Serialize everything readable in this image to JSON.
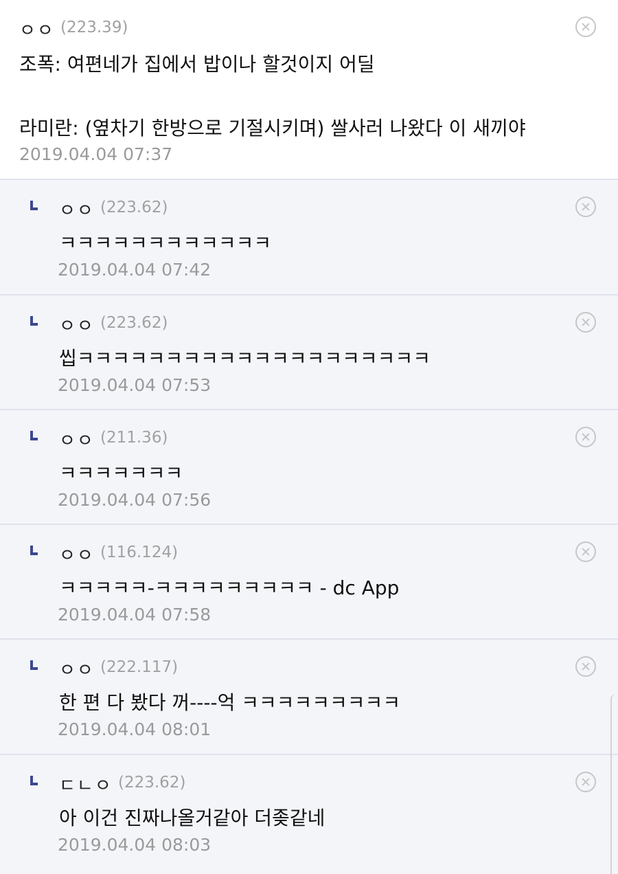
{
  "main_comment": {
    "nickname": "ㅇㅇ",
    "ip": "(223.39)",
    "line1": "조폭: 여편네가 집에서 밥이나 할것이지 어딜",
    "line2": "라미란: (옆차기 한방으로 기절시키며) 쌀사러 나왔다 이 새끼야",
    "date": "2019.04.04 07:37"
  },
  "replies": [
    {
      "nickname": "ㅇㅇ",
      "ip": "(223.62)",
      "text": "ㅋㅋㅋㅋㅋㅋㅋㅋㅋㅋㅋㅋ",
      "date": "2019.04.04 07:42"
    },
    {
      "nickname": "ㅇㅇ",
      "ip": "(223.62)",
      "text": "씹ㅋㅋㅋㅋㅋㅋㅋㅋㅋㅋㅋㅋㅋㅋㅋㅋㅋㅋㅋㅋ",
      "date": "2019.04.04 07:53"
    },
    {
      "nickname": "ㅇㅇ",
      "ip": "(211.36)",
      "text": "ㅋㅋㅋㅋㅋㅋㅋ",
      "date": "2019.04.04 07:56"
    },
    {
      "nickname": "ㅇㅇ",
      "ip": "(116.124)",
      "text": "ㅋㅋㅋㅋㅋ-ㅋㅋㅋㅋㅋㅋㅋㅋㅋ - dc App",
      "date": "2019.04.04 07:58"
    },
    {
      "nickname": "ㅇㅇ",
      "ip": "(222.117)",
      "text": "한 편 다 봤다 꺼----억 ㅋㅋㅋㅋㅋㅋㅋㅋㅋ",
      "date": "2019.04.04 08:01"
    },
    {
      "nickname": "ㄷㄴㅇ",
      "ip": "(223.62)",
      "text": "아 이건 진짜나올거같아 더좆같네",
      "date": "2019.04.04 08:03"
    }
  ],
  "icons": {
    "delete": "circle-x-icon",
    "reply": "reply-corner-icon"
  },
  "colors": {
    "reply_bg": "#f4f5f9",
    "reply_mark": "#3b4890",
    "meta_gray": "#9a9a9a"
  }
}
